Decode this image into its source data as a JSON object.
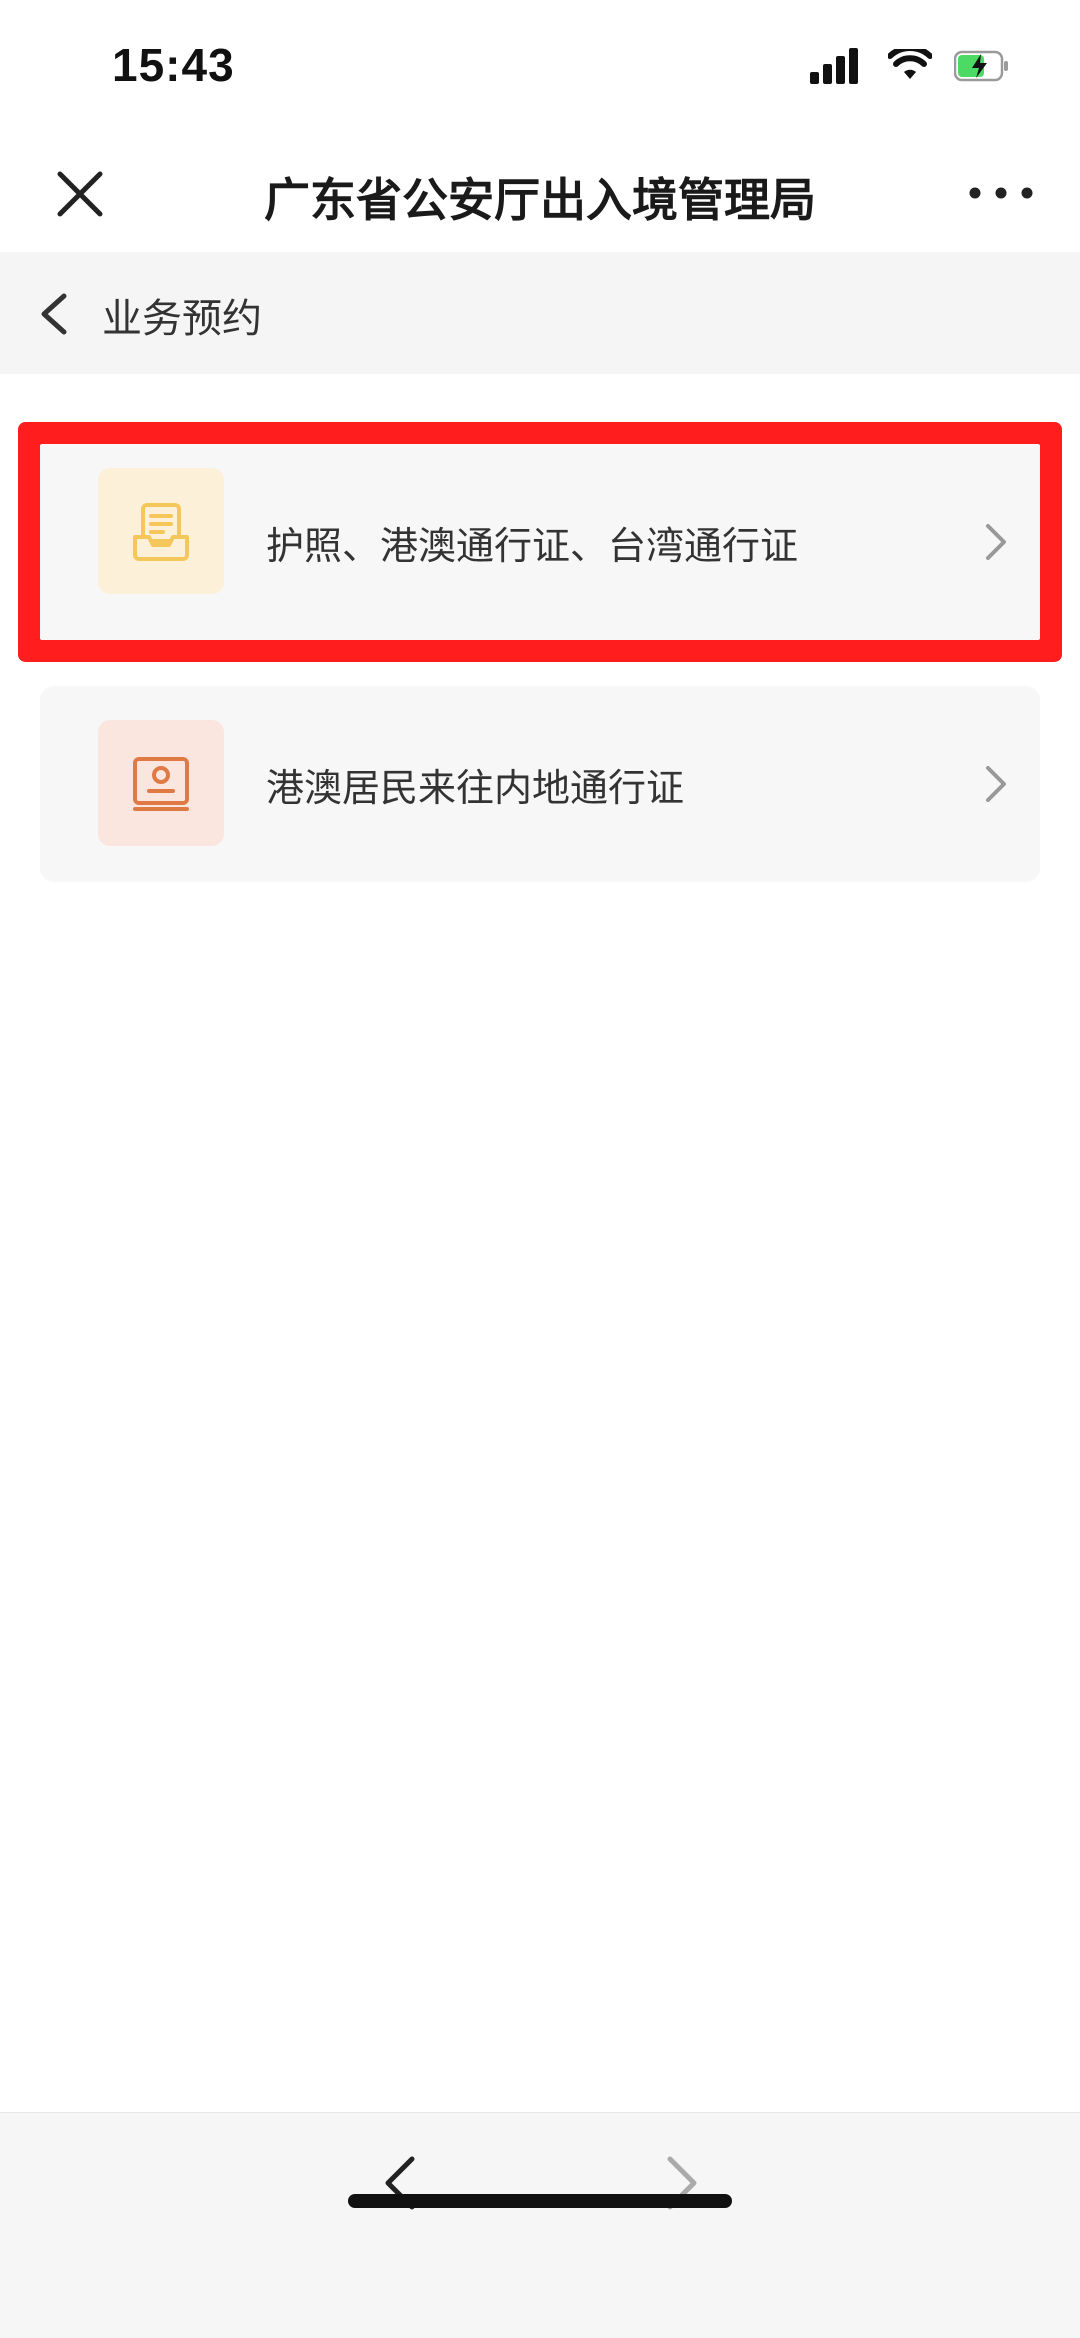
{
  "status_bar": {
    "time": "15:43",
    "icons": [
      "signal-icon",
      "wifi-icon",
      "battery-charging-icon"
    ],
    "battery_color": "#4cd964"
  },
  "nav_bar": {
    "title": "广东省公安厅出入境管理局",
    "close_icon": "close-icon",
    "more_icon": "more-icon"
  },
  "sub_header": {
    "title": "业务预约",
    "back_icon": "chevron-left-icon"
  },
  "services": [
    {
      "label": "护照、港澳通行证、台湾通行证",
      "icon": "document-tray-icon",
      "icon_color": "#f5c65a",
      "icon_bg": "#fdf0d8",
      "highlighted": true
    },
    {
      "label": "港澳居民来往内地通行证",
      "icon": "id-card-icon",
      "icon_color": "#e07a45",
      "icon_bg": "#fbe6df",
      "highlighted": false
    }
  ],
  "highlight_color": "#ff1d1d",
  "bottom_bar": {
    "back_icon": "chevron-left-icon",
    "forward_icon": "chevron-right-icon"
  }
}
